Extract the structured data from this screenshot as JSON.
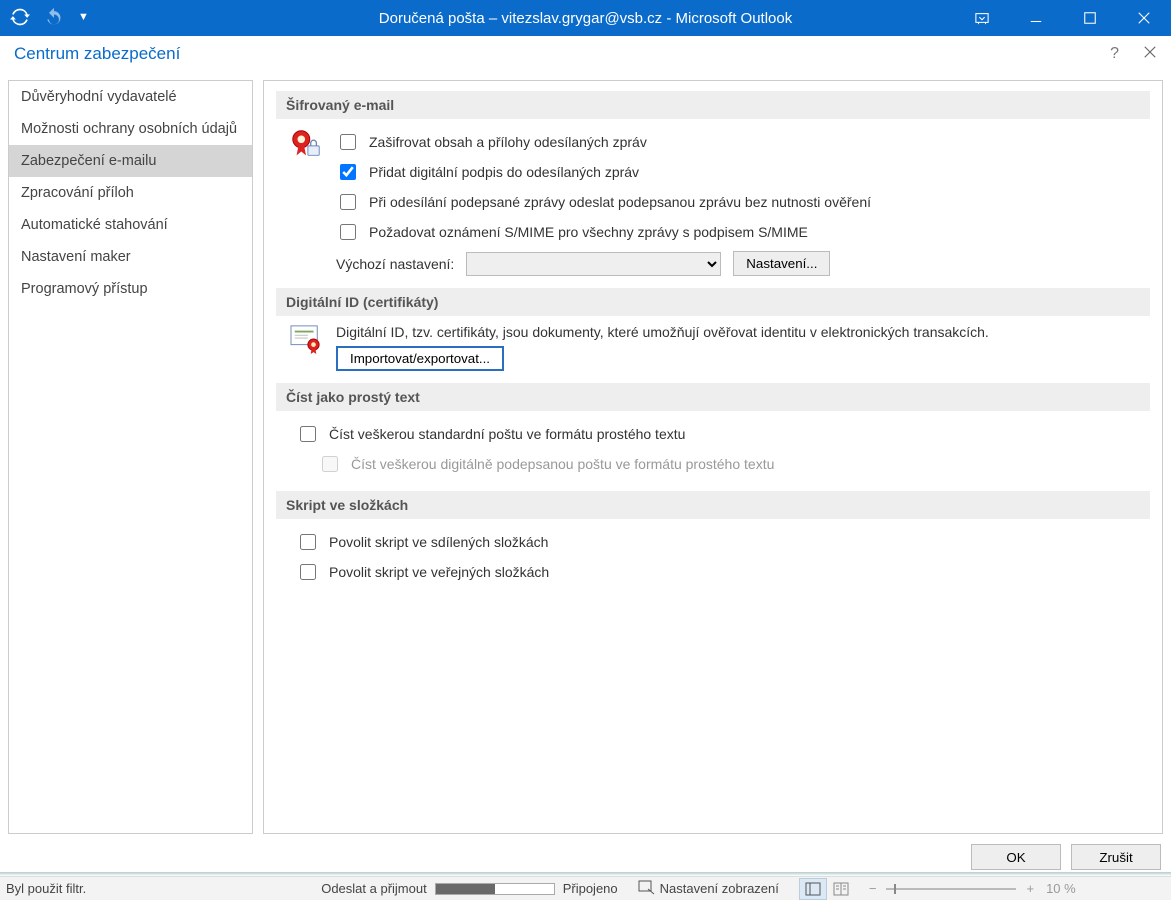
{
  "titlebar": {
    "title": "Doručená pošta – vitezslav.grygar@vsb.cz  -  Microsoft Outlook"
  },
  "dialog": {
    "title": "Centrum zabezpečení",
    "ok": "OK",
    "cancel": "Zrušit"
  },
  "sidebar": {
    "items": [
      "Důvěryhodní vydavatelé",
      "Možnosti ochrany osobních údajů",
      "Zabezpečení e-mailu",
      "Zpracování příloh",
      "Automatické stahování",
      "Nastavení maker",
      "Programový přístup"
    ]
  },
  "sections": {
    "encrypted": {
      "title": "Šifrovaný e-mail",
      "cb1": "Zašifrovat obsah a přílohy odesílaných zpráv",
      "cb2": "Přidat digitální podpis do odesílaných zpráv",
      "cb3": "Při odesílání podepsané zprávy odeslat podepsanou zprávu bez nutnosti ověření",
      "cb4": "Požadovat oznámení S/MIME pro všechny zprávy s podpisem S/MIME",
      "default_label": "Výchozí nastavení:",
      "settings_btn": "Nastavení..."
    },
    "digitalid": {
      "title": "Digitální ID (certifikáty)",
      "desc": "Digitální ID, tzv. certifikáty, jsou dokumenty, které umožňují ověřovat identitu v elektronických transakcích.",
      "import_btn": "Importovat/exportovat..."
    },
    "plaintext": {
      "title": "Číst jako prostý text",
      "cb1": "Číst veškerou standardní poštu ve formátu prostého textu",
      "cb2": "Číst veškerou digitálně podepsanou poštu ve formátu prostého textu"
    },
    "script": {
      "title": "Skript ve složkách",
      "cb1": "Povolit skript ve sdílených složkách",
      "cb2": "Povolit skript ve veřejných složkách"
    }
  },
  "statusbar": {
    "filter": "Byl použit filtr.",
    "sendreceive": "Odeslat a přijmout",
    "connected": "Připojeno",
    "viewsettings": "Nastavení zobrazení",
    "zoom": "10 %"
  }
}
